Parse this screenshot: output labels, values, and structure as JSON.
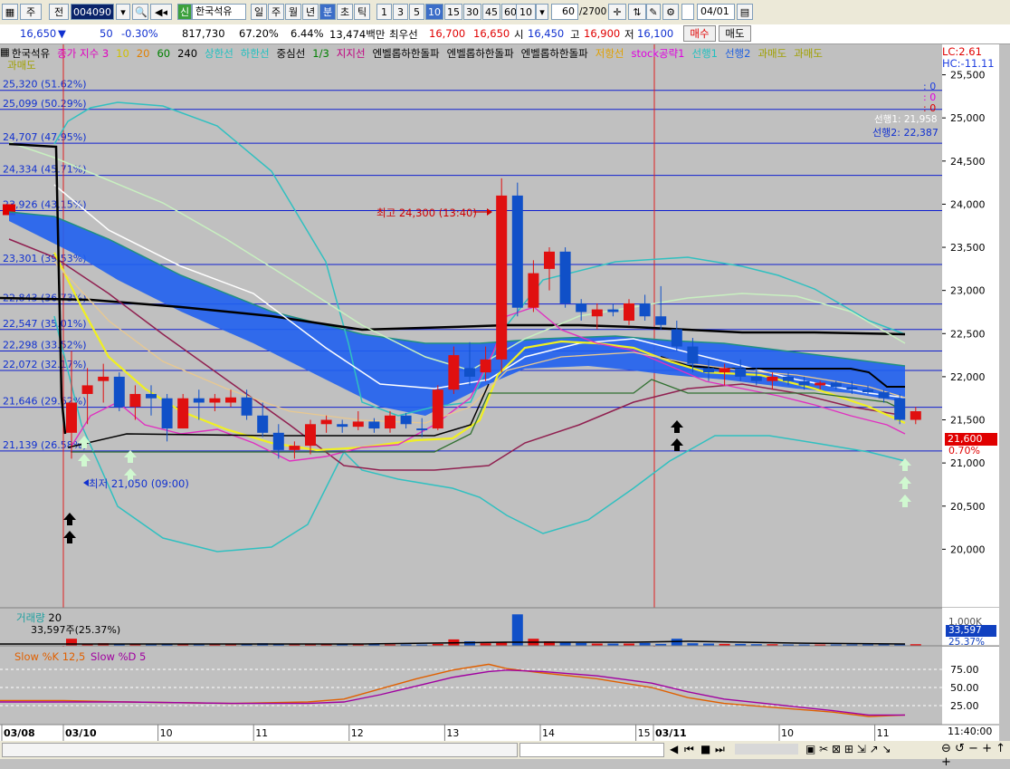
{
  "toolbar": {
    "type_label": "주",
    "view_label": "전",
    "code": "004090",
    "name_badge": "신",
    "name": "한국석유",
    "periods": [
      "일",
      "주",
      "월",
      "년",
      "분",
      "초",
      "틱"
    ],
    "period_selected": "분",
    "intervals": [
      "1",
      "3",
      "5",
      "10",
      "15",
      "30",
      "45",
      "60"
    ],
    "interval_selected": "10",
    "interval_box": "10",
    "count_value": "60",
    "count_total": "/2700",
    "date": "04/01"
  },
  "quote": {
    "price": "16,650",
    "change_arrow": "▼",
    "change": "50",
    "change_pct": "-0.30%",
    "volume": "817,730",
    "vol_ratio": "67.20%",
    "turnover": "6.44%",
    "amount": "13,474백만",
    "best_label": "최우선",
    "best_ask": "16,700",
    "best_bid": "16,650",
    "open_label": "시",
    "open": "16,450",
    "high_label": "고",
    "high": "16,900",
    "low_label": "저",
    "low": "16,100",
    "buy_label": "매수",
    "sell_label": "매도"
  },
  "legend": {
    "items": [
      {
        "text": "한국석유",
        "color": "#000000"
      },
      {
        "text": "종가 지수 3",
        "color": "#e000c0"
      },
      {
        "text": "10",
        "color": "#d0c000"
      },
      {
        "text": "20",
        "color": "#e08000"
      },
      {
        "text": "60",
        "color": "#008000"
      },
      {
        "text": "240",
        "color": "#000000"
      },
      {
        "text": "상한선",
        "color": "#20c0c0"
      },
      {
        "text": "하한선",
        "color": "#20c0c0"
      },
      {
        "text": "중심선",
        "color": "#000000"
      },
      {
        "text": "1/3",
        "color": "#008000"
      },
      {
        "text": "지지선",
        "color": "#c00080"
      },
      {
        "text": "엔벨롭하한돌파",
        "color": "#000000"
      },
      {
        "text": "엔벨롭하한돌파",
        "color": "#000000"
      },
      {
        "text": "엔벨롭하한돌파",
        "color": "#000000"
      },
      {
        "text": "저항선",
        "color": "#e0a000"
      },
      {
        "text": "stock공략1",
        "color": "#e000e0"
      },
      {
        "text": "선행1",
        "color": "#20c0c0"
      },
      {
        "text": "선행2",
        "color": "#2060e0"
      },
      {
        "text": "과매도",
        "color": "#a0a000"
      },
      {
        "text": "과매도",
        "color": "#a0a000"
      }
    ],
    "second_line": "과매도",
    "lc": "LC:2.61",
    "hc": "HC:-11.11"
  },
  "annotations": {
    "high_text": "최고 24,300 (13:40)",
    "low_text": "최저 21,050 (09:00)",
    "span1": "선행1: 21,958",
    "span2": "선행2: 22,387",
    "zeros": [
      ": 0",
      ": 0",
      ": 0"
    ],
    "last_price": "21,600",
    "last_pct": "0.70%"
  },
  "levels": [
    {
      "label": "25,320 (51.62%)",
      "value": 25320
    },
    {
      "label": "25,099 (50.29%)",
      "value": 25099
    },
    {
      "label": "24,707 (47.95%)",
      "value": 24707
    },
    {
      "label": "24,334 (45.71%)",
      "value": 24334
    },
    {
      "label": "23,926 (43.15%)",
      "value": 23926
    },
    {
      "label": "23,301 (39.53%)",
      "value": 23301
    },
    {
      "label": "22,843 (36.73%)",
      "value": 22843
    },
    {
      "label": "22,547 (35.01%)",
      "value": 22547
    },
    {
      "label": "22,298 (33.52%)",
      "value": 22298
    },
    {
      "label": "22,072 (32.17%)",
      "value": 22072
    },
    {
      "label": "21,646 (29.62%)",
      "value": 21646
    },
    {
      "label": "21,139 (26.58%)",
      "value": 21139
    }
  ],
  "volume_panel": {
    "title": "거래량",
    "period": "20",
    "value_text": "33,597주(25.37%)",
    "axis_label": "1,000K",
    "last": "33,597",
    "last_pct": "25.37%"
  },
  "stoch_panel": {
    "k_label": "Slow %K 12,5",
    "d_label": "Slow %D 5",
    "ticks": [
      "75.00",
      "50.00",
      "25.00"
    ]
  },
  "xaxis": {
    "labels": [
      {
        "text": "03/08",
        "idx": -5.5
      },
      {
        "text": "03/10",
        "idx": 0
      },
      {
        "text": "10",
        "idx": 6
      },
      {
        "text": "11",
        "idx": 12
      },
      {
        "text": "12",
        "idx": 18
      },
      {
        "text": "13",
        "idx": 24
      },
      {
        "text": "14",
        "idx": 30
      },
      {
        "text": "15",
        "idx": 36
      },
      {
        "text": "03/11",
        "idx": 39
      },
      {
        "text": "10",
        "idx": 45
      },
      {
        "text": "11",
        "idx": 51
      }
    ],
    "time_right": "11:40:00"
  },
  "chart_data": {
    "type": "candlestick",
    "title": "",
    "ylim": [
      19500,
      25800
    ],
    "y_ticks": [
      20000,
      20500,
      21000,
      21500,
      22000,
      22500,
      23000,
      23500,
      24000,
      24500,
      25000,
      25500
    ],
    "candles": [
      {
        "o": 21350,
        "h": 22300,
        "l": 21050,
        "c": 21700
      },
      {
        "o": 21800,
        "h": 22100,
        "l": 21450,
        "c": 21900
      },
      {
        "o": 21950,
        "h": 22150,
        "l": 21700,
        "c": 22000
      },
      {
        "o": 22000,
        "h": 22050,
        "l": 21600,
        "c": 21650
      },
      {
        "o": 21650,
        "h": 21900,
        "l": 21500,
        "c": 21800
      },
      {
        "o": 21800,
        "h": 21900,
        "l": 21550,
        "c": 21750
      },
      {
        "o": 21750,
        "h": 21800,
        "l": 21250,
        "c": 21400
      },
      {
        "o": 21400,
        "h": 21800,
        "l": 21400,
        "c": 21750
      },
      {
        "o": 21750,
        "h": 21850,
        "l": 21500,
        "c": 21700
      },
      {
        "o": 21700,
        "h": 21800,
        "l": 21600,
        "c": 21750
      },
      {
        "o": 21700,
        "h": 21850,
        "l": 21650,
        "c": 21760
      },
      {
        "o": 21760,
        "h": 21850,
        "l": 21500,
        "c": 21550
      },
      {
        "o": 21550,
        "h": 21700,
        "l": 21300,
        "c": 21350
      },
      {
        "o": 21350,
        "h": 21450,
        "l": 21050,
        "c": 21150
      },
      {
        "o": 21150,
        "h": 21250,
        "l": 21050,
        "c": 21200
      },
      {
        "o": 21200,
        "h": 21500,
        "l": 21100,
        "c": 21450
      },
      {
        "o": 21450,
        "h": 21550,
        "l": 21350,
        "c": 21500
      },
      {
        "o": 21450,
        "h": 21500,
        "l": 21350,
        "c": 21420
      },
      {
        "o": 21420,
        "h": 21600,
        "l": 21380,
        "c": 21480
      },
      {
        "o": 21480,
        "h": 21520,
        "l": 21350,
        "c": 21400
      },
      {
        "o": 21400,
        "h": 21600,
        "l": 21350,
        "c": 21550
      },
      {
        "o": 21550,
        "h": 21580,
        "l": 21400,
        "c": 21450
      },
      {
        "o": 21400,
        "h": 21520,
        "l": 21300,
        "c": 21380
      },
      {
        "o": 21400,
        "h": 21900,
        "l": 21380,
        "c": 21850
      },
      {
        "o": 21850,
        "h": 22350,
        "l": 21800,
        "c": 22250
      },
      {
        "o": 22100,
        "h": 22400,
        "l": 21900,
        "c": 22000
      },
      {
        "o": 22050,
        "h": 22350,
        "l": 21950,
        "c": 22200
      },
      {
        "o": 22200,
        "h": 24300,
        "l": 22050,
        "c": 24100
      },
      {
        "o": 24100,
        "h": 24250,
        "l": 22700,
        "c": 22800
      },
      {
        "o": 22800,
        "h": 23350,
        "l": 22750,
        "c": 23200
      },
      {
        "o": 23250,
        "h": 23500,
        "l": 23000,
        "c": 23450
      },
      {
        "o": 23450,
        "h": 23500,
        "l": 22800,
        "c": 22850
      },
      {
        "o": 22850,
        "h": 22900,
        "l": 22650,
        "c": 22750
      },
      {
        "o": 22700,
        "h": 22850,
        "l": 22550,
        "c": 22780
      },
      {
        "o": 22780,
        "h": 22850,
        "l": 22700,
        "c": 22750
      },
      {
        "o": 22650,
        "h": 22900,
        "l": 22600,
        "c": 22850
      },
      {
        "o": 22850,
        "h": 22950,
        "l": 22650,
        "c": 22700
      },
      {
        "o": 22700,
        "h": 23050,
        "l": 22550,
        "c": 22600
      },
      {
        "o": 22550,
        "h": 22650,
        "l": 22300,
        "c": 22350
      },
      {
        "o": 22350,
        "h": 22450,
        "l": 22050,
        "c": 22150
      },
      {
        "o": 22100,
        "h": 22200,
        "l": 21950,
        "c": 22050
      },
      {
        "o": 22050,
        "h": 22150,
        "l": 21900,
        "c": 22100
      },
      {
        "o": 22100,
        "h": 22200,
        "l": 21950,
        "c": 22000
      },
      {
        "o": 22000,
        "h": 22100,
        "l": 21900,
        "c": 21950
      },
      {
        "o": 21950,
        "h": 22050,
        "l": 21850,
        "c": 22000
      },
      {
        "o": 22000,
        "h": 22050,
        "l": 21900,
        "c": 21950
      },
      {
        "o": 21950,
        "h": 22000,
        "l": 21850,
        "c": 21900
      },
      {
        "o": 21900,
        "h": 21950,
        "l": 21850,
        "c": 21930
      },
      {
        "o": 21930,
        "h": 21950,
        "l": 21850,
        "c": 21880
      },
      {
        "o": 21880,
        "h": 21950,
        "l": 21800,
        "c": 21850
      },
      {
        "o": 21850,
        "h": 21900,
        "l": 21800,
        "c": 21820
      },
      {
        "o": 21820,
        "h": 21850,
        "l": 21700,
        "c": 21750
      },
      {
        "o": 21750,
        "h": 21800,
        "l": 21450,
        "c": 21500
      },
      {
        "o": 21500,
        "h": 21650,
        "l": 21450,
        "c": 21600
      }
    ],
    "volume": [
      220,
      60,
      80,
      60,
      60,
      40,
      70,
      50,
      40,
      40,
      40,
      60,
      80,
      70,
      40,
      40,
      60,
      50,
      40,
      50,
      40,
      40,
      40,
      60,
      200,
      140,
      80,
      110,
      980,
      220,
      140,
      110,
      90,
      70,
      70,
      70,
      90,
      60,
      220,
      80,
      70,
      60,
      60,
      50,
      50,
      40,
      40,
      40,
      40,
      40,
      40,
      40,
      40,
      50
    ],
    "volume_ylim": [
      0,
      1100
    ]
  },
  "marks": {
    "black_up": [
      0,
      39,
      39
    ],
    "light_up": [
      1,
      4,
      53
    ]
  }
}
